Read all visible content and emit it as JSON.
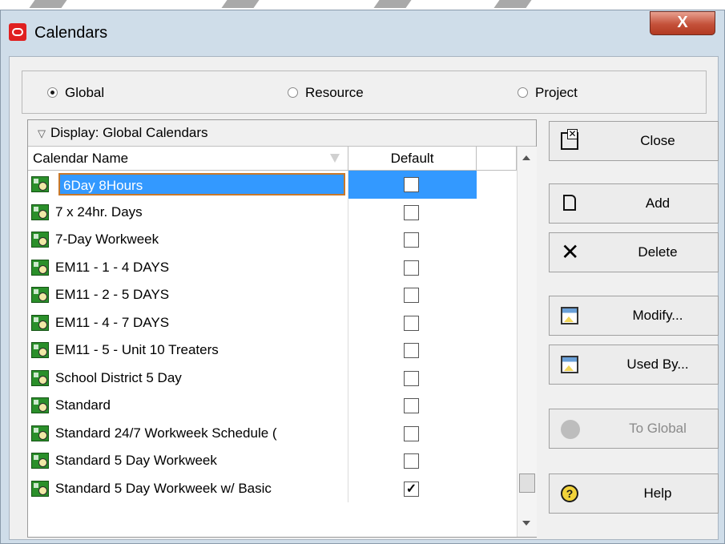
{
  "window": {
    "title": "Calendars",
    "close_glyph": "X"
  },
  "scope": {
    "options": [
      {
        "label": "Global",
        "selected": true
      },
      {
        "label": "Resource",
        "selected": false
      },
      {
        "label": "Project",
        "selected": false
      }
    ]
  },
  "grid": {
    "display_label": "Display: Global Calendars",
    "columns": {
      "name": "Calendar Name",
      "default": "Default"
    },
    "rows": [
      {
        "name": "6Day 8Hours",
        "default": false,
        "selected": true
      },
      {
        "name": "7 x 24hr. Days",
        "default": false
      },
      {
        "name": "7-Day Workweek",
        "default": false
      },
      {
        "name": "EM11 - 1 - 4 DAYS",
        "default": false
      },
      {
        "name": "EM11 - 2 - 5 DAYS",
        "default": false
      },
      {
        "name": "EM11 - 4 - 7 DAYS",
        "default": false
      },
      {
        "name": "EM11 - 5 - Unit 10 Treaters",
        "default": false
      },
      {
        "name": "School District 5 Day",
        "default": false
      },
      {
        "name": "Standard",
        "default": false
      },
      {
        "name": "Standard 24/7 Workweek Schedule (",
        "default": false
      },
      {
        "name": "Standard 5 Day Workweek",
        "default": false
      },
      {
        "name": "Standard 5 Day Workweek w/ Basic",
        "default": true
      }
    ],
    "check_mark": "✓"
  },
  "buttons": {
    "close": "Close",
    "add": "Add",
    "delete": "Delete",
    "modify": "Modify...",
    "used_by": "Used By...",
    "to_global": "To Global",
    "help": "Help",
    "help_glyph": "?",
    "delete_glyph": "✕"
  },
  "colors": {
    "selection": "#3399ff",
    "window_frame": "#cfdde9",
    "close_button": "#c4513a"
  }
}
